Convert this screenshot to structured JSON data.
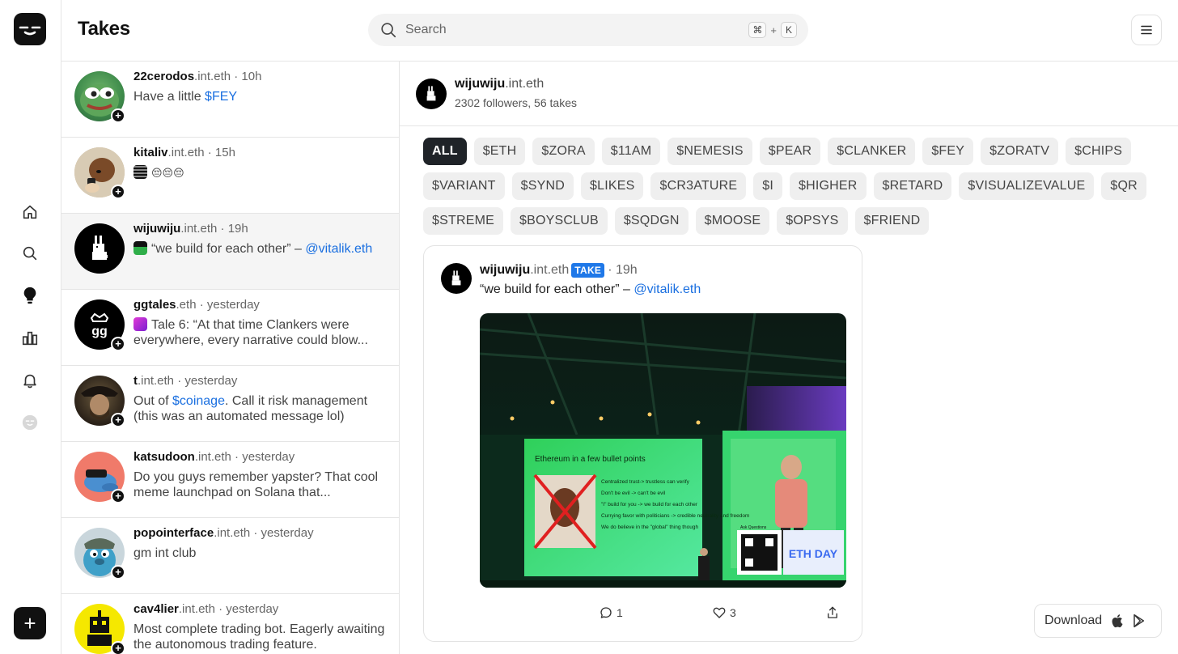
{
  "header": {
    "title": "Takes",
    "search_placeholder": "Search",
    "shortcut_key1": "⌘",
    "shortcut_plus": "+",
    "shortcut_key2": "K"
  },
  "rail": {
    "icons": [
      "home-icon",
      "search-icon",
      "lightbulb-icon",
      "chart-icon",
      "bell-icon",
      "profile-icon"
    ],
    "new_button": "+"
  },
  "feed": [
    {
      "handle": "22cerodos",
      "domain": ".int.eth",
      "time": " · 10h",
      "text": "Have a little ",
      "link": "$FEY",
      "emojis": ""
    },
    {
      "handle": "kitaliv",
      "domain": ".int.eth",
      "time": " · 15h",
      "text": "",
      "link": "",
      "emojis": "😔😔😔"
    },
    {
      "handle": "wijuwiju",
      "domain": ".int.eth",
      "time": " · 19h",
      "text": "“we build for each other” – ",
      "link": "@vitalik.eth",
      "emojis": ""
    },
    {
      "handle": "ggtales",
      "domain": ".eth",
      "time": " · yesterday",
      "text": "Tale 6: “At that time Clankers were everywhere, every narrative could blow...",
      "link": "",
      "emojis": ""
    },
    {
      "handle": "t",
      "domain": ".int.eth",
      "time": " · yesterday",
      "text_before": "Out of ",
      "link": "$coinage",
      "text": ". Call it risk management (this was an automated message lol)",
      "emojis": ""
    },
    {
      "handle": "katsudoon",
      "domain": ".int.eth",
      "time": " · yesterday",
      "text": "Do you guys remember yapster? That cool meme launchpad on Solana that...",
      "link": "",
      "emojis": ""
    },
    {
      "handle": "popointerface",
      "domain": ".int.eth",
      "time": " · yesterday",
      "text": "gm int club",
      "link": "",
      "emojis": ""
    },
    {
      "handle": "cav4lier",
      "domain": ".int.eth",
      "time": " · yesterday",
      "text": "Most complete trading bot. Eagerly awaiting the autonomous trading feature.",
      "link": "",
      "emojis": ""
    }
  ],
  "profile": {
    "handle": "wijuwiju",
    "domain": ".int.eth",
    "stats": "2302 followers, 56 takes"
  },
  "chips": [
    "ALL",
    "$ETH",
    "$ZORA",
    "$11AM",
    "$NEMESIS",
    "$PEAR",
    "$CLANKER",
    "$FEY",
    "$ZORATV",
    "$CHIPS",
    "$VARIANT",
    "$SYND",
    "$LIKES",
    "$CR3ATURE",
    "$I",
    "$HIGHER",
    "$RETARD",
    "$VISUALIZEVALUE",
    "$QR",
    "$STREME",
    "$BOYSCLUB",
    "$SQDGN",
    "$MOOSE",
    "$OPSYS",
    "$FRIEND"
  ],
  "post": {
    "handle": "wijuwiju",
    "domain": ".int.eth",
    "badge": "TAKE",
    "time": "· 19h",
    "text": "“we build for each other” – ",
    "mention": "@vitalik.eth",
    "slide_title": "Ethereum in a few bullet points",
    "slide_bullets": [
      "Centralized trust-> trustless can verify",
      "Don't be evil -> can't be evil",
      "\"I\" build for you -> we build for each other",
      "Currying favor with politicians -> credible neutrality and freedom",
      "We do believe in the \"global\" thing though"
    ],
    "qr_label": "Ask Questions",
    "event_logo": "ETH DAY",
    "comments": "1",
    "likes": "3"
  },
  "download": {
    "label": "Download"
  },
  "colors": {
    "accent": "#1a6fe0",
    "badge": "#1f78e8",
    "active_chip": "#1f2328"
  }
}
